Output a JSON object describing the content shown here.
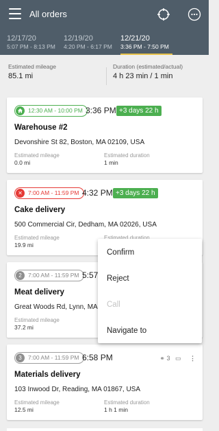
{
  "header": {
    "title": "All orders",
    "icons": [
      "menu-icon",
      "target-icon",
      "more-icon"
    ]
  },
  "tabs": [
    {
      "date": "12/17/20",
      "time": "5:07 PM - 8:13 PM"
    },
    {
      "date": "12/19/20",
      "time": "4:20 PM - 6:17 PM"
    },
    {
      "date": "12/21/20",
      "time": "3:36 PM - 7:50 PM",
      "active": true
    }
  ],
  "summary": {
    "mileage_label": "Estimated mileage",
    "mileage_value": "85.1  mi",
    "duration_label": "Duration (estimated/actual)",
    "duration_value": "4 h 23 min / 1 min"
  },
  "labels": {
    "est_mileage": "Estimated mileage",
    "est_duration": "Estimated duration"
  },
  "orders": [
    {
      "window": "12:30 AM - 10:00 PM",
      "status_icon": "home-icon",
      "time": "3:36 PM",
      "days": "+3 days 22 h",
      "title": "Warehouse #2",
      "address": "Devonshire St 82, Boston, MA 02109, USA",
      "mileage": "0.0  mi",
      "duration": "1 min"
    },
    {
      "window": "7:00 AM - 11:59 PM",
      "status_icon": "cancel-icon",
      "time": "4:32 PM",
      "days": "+3 days 22 h",
      "title": "Cake delivery",
      "address": "500 Commercial Cir, Dedham, MA 02026, USA",
      "mileage": "19.9  mi",
      "duration": ""
    },
    {
      "window": "7:00 AM - 11:59 PM",
      "number": "2",
      "time": "5:57",
      "title": "Meat delivery",
      "address": "Great Woods Rd, Lynn, MA 01",
      "mileage": "37.2  mi",
      "duration": ""
    },
    {
      "window": "7:00 AM - 11:59 PM",
      "number": "3",
      "time": "6:58 PM",
      "title": "Materials delivery",
      "address": "103 Inwood Dr, Reading, MA 01867, USA",
      "mileage": "12.5  mi",
      "duration": "1 h 1 min",
      "attachments": "3"
    }
  ],
  "context_menu": {
    "items": [
      {
        "label": "Confirm",
        "enabled": true
      },
      {
        "label": "Reject",
        "enabled": true
      },
      {
        "label": "Call",
        "enabled": false
      },
      {
        "label": "Navigate to",
        "enabled": true
      }
    ]
  },
  "colors": {
    "header_bg": "#4f5d69",
    "accent_yellow": "#e8c24a",
    "green": "#4caf50",
    "red": "#e53935"
  }
}
